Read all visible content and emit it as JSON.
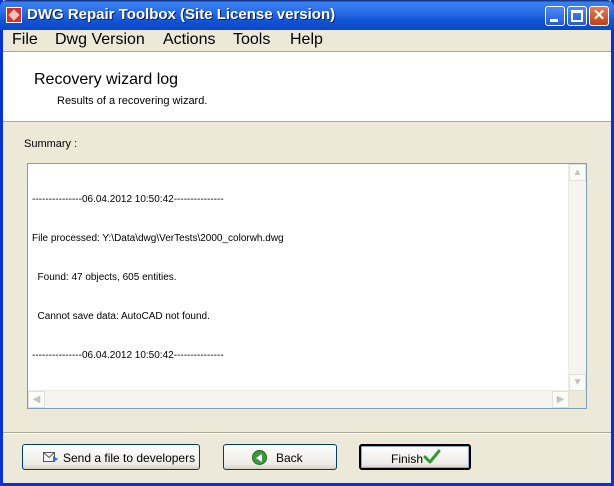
{
  "window": {
    "title": "DWG Repair Toolbox (Site License version)",
    "close_glyph": "✕"
  },
  "menu": [
    {
      "label": "File"
    },
    {
      "label": "Dwg Version"
    },
    {
      "label": "Actions"
    },
    {
      "label": "Tools"
    },
    {
      "label": "Help"
    }
  ],
  "header": {
    "title": "Recovery wizard log",
    "subtitle": "Results of a recovering wizard."
  },
  "summary": {
    "label": "Summary :",
    "log_lines": [
      "---------------06.04.2012 10:50:42---------------",
      "File processed: Y:\\Data\\dwg\\VerTests\\2000_colorwh.dwg",
      "  Found: 47 objects, 605 entities.",
      "  Cannot save data: AutoCAD not found.",
      "---------------06.04.2012 10:50:42---------------"
    ]
  },
  "buttons": {
    "send": "Send a file to developers",
    "back": "Back",
    "finish": "Finish"
  },
  "icons": {
    "app": "app-icon",
    "send": "mail-send-icon",
    "back": "back-arrow-icon",
    "finish": "checkmark-icon"
  },
  "colors": {
    "titlebar": "#0F54D6",
    "window_bg": "#ECE9D8",
    "check_green": "#2E9E2E"
  }
}
